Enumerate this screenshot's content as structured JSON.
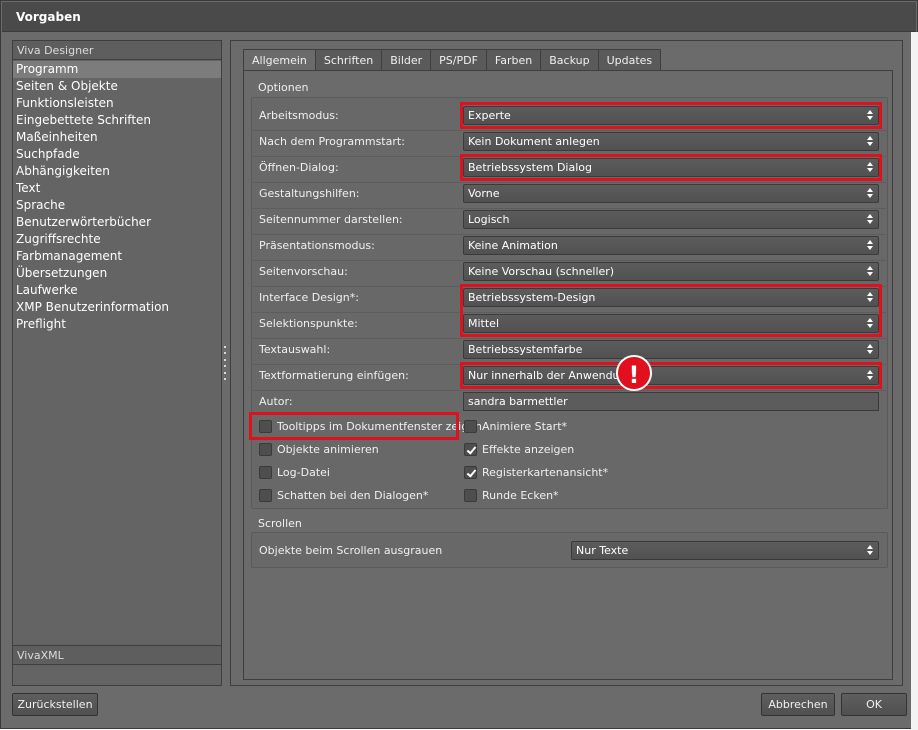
{
  "window": {
    "title": "Vorgaben"
  },
  "sidebar": {
    "header": "Viva Designer",
    "items": [
      {
        "label": "Programm",
        "selected": true
      },
      {
        "label": "Seiten & Objekte"
      },
      {
        "label": "Funktionsleisten"
      },
      {
        "label": "Eingebettete Schriften"
      },
      {
        "label": "Maßeinheiten"
      },
      {
        "label": "Suchpfade"
      },
      {
        "label": "Abhängigkeiten"
      },
      {
        "label": "Text"
      },
      {
        "label": "Sprache"
      },
      {
        "label": "Benutzerwörterbücher"
      },
      {
        "label": "Zugriffsrechte"
      },
      {
        "label": "Farbmanagement"
      },
      {
        "label": "Übersetzungen"
      },
      {
        "label": "Laufwerke"
      },
      {
        "label": "XMP Benutzerinformation"
      },
      {
        "label": "Preflight"
      }
    ],
    "footer": "VivaXML"
  },
  "tabs": [
    "Allgemein",
    "Schriften",
    "Bilder",
    "PS/PDF",
    "Farben",
    "Backup",
    "Updates"
  ],
  "active_tab": "Allgemein",
  "optionen": {
    "title": "Optionen",
    "rows": [
      {
        "label": "Arbeitsmodus:",
        "value": "Experte"
      },
      {
        "label": "Nach dem Programmstart:",
        "value": "Kein Dokument anlegen"
      },
      {
        "label": "Öffnen-Dialog:",
        "value": "Betriebssystem Dialog"
      },
      {
        "label": "Gestaltungshilfen:",
        "value": "Vorne"
      },
      {
        "label": "Seitennummer darstellen:",
        "value": "Logisch"
      },
      {
        "label": "Präsentationsmodus:",
        "value": "Keine Animation"
      },
      {
        "label": "Seitenvorschau:",
        "value": "Keine Vorschau (schneller)"
      },
      {
        "label": "Interface Design*:",
        "value": "Betriebssystem-Design"
      },
      {
        "label": "Selektionspunkte:",
        "value": "Mittel"
      },
      {
        "label": "Textauswahl:",
        "value": "Betriebssystemfarbe"
      },
      {
        "label": "Textformatierung einfügen:",
        "value": "Nur innerhalb der Anwendung"
      }
    ],
    "autor_label": "Autor:",
    "autor_value": "sandra barmettler",
    "checkboxes_left": [
      {
        "label": "Tooltipps im Dokumentfenster zeigen",
        "checked": false
      },
      {
        "label": "Objekte animieren",
        "checked": false
      },
      {
        "label": "Log-Datei",
        "checked": false
      },
      {
        "label": "Schatten bei den Dialogen*",
        "checked": false
      }
    ],
    "checkboxes_right": [
      {
        "label": "Animiere Start*",
        "checked": false
      },
      {
        "label": "Effekte anzeigen",
        "checked": true
      },
      {
        "label": "Registerkartenansicht*",
        "checked": true
      },
      {
        "label": "Runde Ecken*",
        "checked": false
      }
    ]
  },
  "scrollen": {
    "title": "Scrollen",
    "label": "Objekte beim Scrollen ausgrauen",
    "value": "Nur Texte"
  },
  "warning_icon": "exclamation-icon",
  "warning_glyph": "!",
  "buttons": {
    "reset": "Zurückstellen",
    "cancel": "Abbrechen",
    "ok": "OK"
  },
  "colors": {
    "highlight": "#e0101e",
    "window_bg": "#6b6b6b",
    "titlebar_bg": "#4a4a4a"
  }
}
